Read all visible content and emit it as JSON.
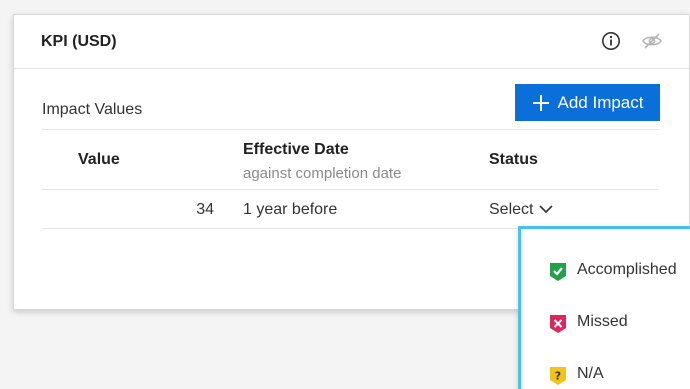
{
  "card": {
    "title": "KPI (USD)",
    "icons": {
      "info": "info-icon",
      "visibility": "eye-slash-icon"
    }
  },
  "impact": {
    "section_title": "Impact Values",
    "add_button_label": "Add Impact",
    "add_button_icon": "plus-icon",
    "accent_color": "#0a6fd8"
  },
  "table": {
    "columns": {
      "value": "Value",
      "effective_date": "Effective Date",
      "effective_date_sub": "against completion date",
      "status": "Status"
    },
    "rows": [
      {
        "value": "34",
        "effective_date": "1 year before",
        "status": "Select"
      }
    ]
  },
  "status_dropdown": {
    "highlight_color": "#44c3ef",
    "options": [
      {
        "label": "Accomplished",
        "icon": "check-shield-icon",
        "color": "#22a04b"
      },
      {
        "label": "Missed",
        "icon": "x-shield-icon",
        "color": "#e0245e"
      },
      {
        "label": "N/A",
        "icon": "question-shield-icon",
        "color": "#f2c318"
      }
    ]
  }
}
